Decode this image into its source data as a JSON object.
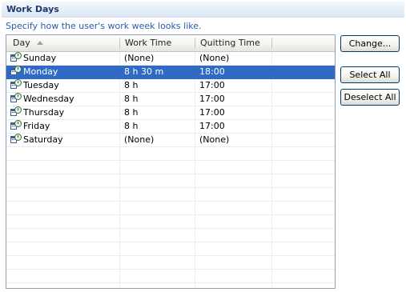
{
  "section": {
    "title": "Work Days",
    "description": "Specify how the user's work week looks like."
  },
  "table": {
    "columns": {
      "day": "Day",
      "work_time": "Work Time",
      "quitting_time": "Quitting Time"
    },
    "sort_column": "Day",
    "sort_direction": "ascending",
    "rows": [
      {
        "day": "Sunday",
        "work_time": "(None)",
        "quitting_time": "(None)",
        "selected": false,
        "icon": "calendar-clock-icon"
      },
      {
        "day": "Monday",
        "work_time": "8 h 30 m",
        "quitting_time": "18:00",
        "selected": true,
        "icon": "calendar-clock-icon"
      },
      {
        "day": "Tuesday",
        "work_time": "8 h",
        "quitting_time": "17:00",
        "selected": false,
        "icon": "calendar-clock-icon"
      },
      {
        "day": "Wednesday",
        "work_time": "8 h",
        "quitting_time": "17:00",
        "selected": false,
        "icon": "calendar-clock-icon"
      },
      {
        "day": "Thursday",
        "work_time": "8 h",
        "quitting_time": "17:00",
        "selected": false,
        "icon": "calendar-clock-icon"
      },
      {
        "day": "Friday",
        "work_time": "8 h",
        "quitting_time": "17:00",
        "selected": false,
        "icon": "calendar-clock-icon"
      },
      {
        "day": "Saturday",
        "work_time": "(None)",
        "quitting_time": "(None)",
        "selected": false,
        "icon": "calendar-clock-icon"
      }
    ]
  },
  "buttons": {
    "change": "Change...",
    "select_all": "Select All",
    "deselect_all": "Deselect All"
  },
  "colors": {
    "selection": "#316ac5",
    "title_text": "#1f3a6e",
    "description_text": "#2a5aa8"
  }
}
